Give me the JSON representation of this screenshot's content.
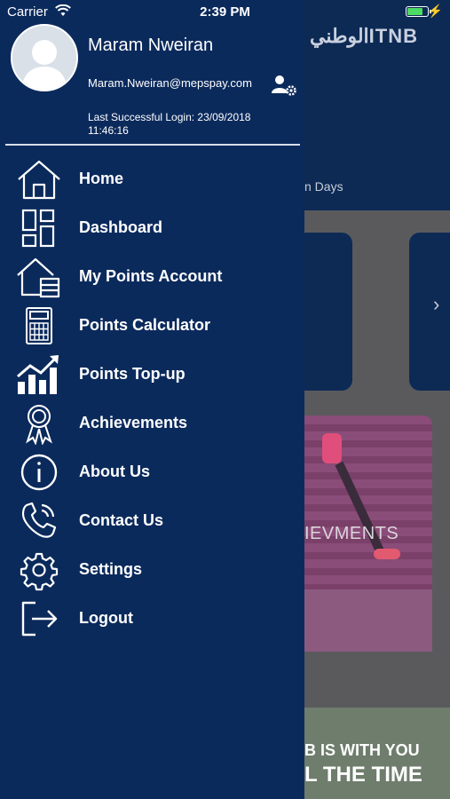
{
  "status_bar": {
    "carrier": "Carrier",
    "time": "2:39 PM",
    "battery_level": 0.8
  },
  "drawer": {
    "user": {
      "name": "Maram Nweiran",
      "email": "Maram.Nweiran@mepspay.com",
      "last_login_line1": "Last Successful Login: 23/09/2018",
      "last_login_line2": "11:46:16"
    },
    "menu": [
      {
        "label": "Home",
        "icon": "home-icon"
      },
      {
        "label": "Dashboard",
        "icon": "dashboard-icon"
      },
      {
        "label": " My Points Account",
        "icon": "points-account-icon"
      },
      {
        "label": "Points Calculator",
        "icon": "calculator-icon"
      },
      {
        "label": "Points Top-up",
        "icon": "chart-up-icon"
      },
      {
        "label": "Achievements",
        "icon": "award-icon"
      },
      {
        "label": "About Us",
        "icon": "info-icon"
      },
      {
        "label": "Contact Us",
        "icon": "phone-icon"
      },
      {
        "label": "Settings",
        "icon": "gear-icon"
      },
      {
        "label": "Logout",
        "icon": "logout-icon"
      }
    ]
  },
  "background": {
    "logo_text": "الوطنيITNB",
    "days_text": "n Days",
    "achievements_text": "IEVMENTS",
    "banner_line1": "B IS WITH YOU",
    "banner_line2": "L THE TIME"
  },
  "colors": {
    "drawer_bg": "#0b2a5c",
    "text": "#ffffff",
    "battery_green": "#4cd964"
  }
}
